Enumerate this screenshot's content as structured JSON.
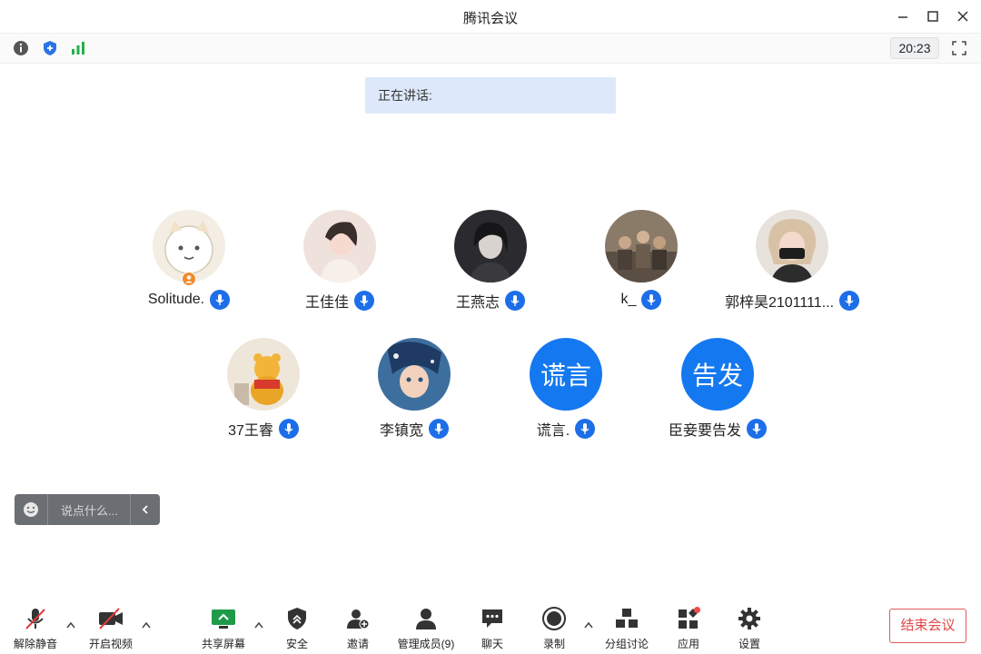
{
  "window": {
    "title": "腾讯会议"
  },
  "topbar": {
    "time": "20:23"
  },
  "speaking": {
    "label": "正在讲话:"
  },
  "participants": [
    {
      "name": "Solitude.",
      "avatar_type": "image",
      "avatar_desc": "cat-avatar",
      "host": true
    },
    {
      "name": "王佳佳",
      "avatar_type": "image",
      "avatar_desc": "photo-avatar"
    },
    {
      "name": "王燕志",
      "avatar_type": "image",
      "avatar_desc": "photo-avatar"
    },
    {
      "name": "k_",
      "avatar_type": "image",
      "avatar_desc": "group-photo-avatar"
    },
    {
      "name": "郭梓昊2101111...",
      "avatar_type": "image",
      "avatar_desc": "photo-avatar"
    },
    {
      "name": "37王睿",
      "avatar_type": "image",
      "avatar_desc": "bear-toy-avatar"
    },
    {
      "name": "李镇宽",
      "avatar_type": "image",
      "avatar_desc": "anime-avatar"
    },
    {
      "name": "谎言.",
      "avatar_type": "text",
      "avatar_text": "谎言"
    },
    {
      "name": "臣妾要告发",
      "avatar_type": "text",
      "avatar_text": "告发"
    }
  ],
  "chat": {
    "placeholder": "说点什么..."
  },
  "toolbar": {
    "unmute": "解除静音",
    "start_video": "开启视频",
    "share_screen": "共享屏幕",
    "security": "安全",
    "invite": "邀请",
    "manage_members": "管理成员(9)",
    "chat": "聊天",
    "record": "录制",
    "breakout": "分组讨论",
    "apps": "应用",
    "settings": "设置",
    "end_meeting": "结束会议"
  },
  "colors": {
    "accent": "#1d6ee8",
    "end_red": "#e04848",
    "speaking_bg": "#dde9fa"
  }
}
